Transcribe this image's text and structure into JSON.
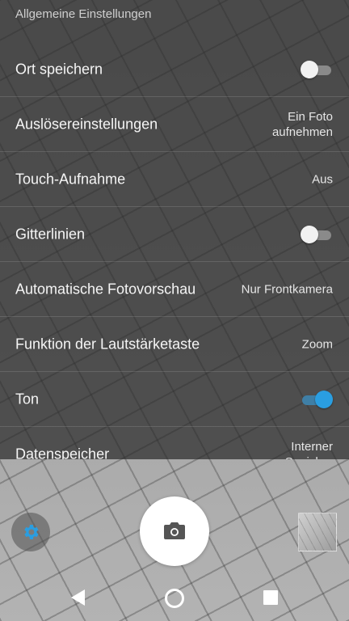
{
  "settings": {
    "section_title": "Allgemeine Einstellungen",
    "rows": [
      {
        "label": "Ort speichern",
        "type": "toggle",
        "on": false
      },
      {
        "label": "Auslösereinstellungen",
        "type": "value",
        "value": "Ein Foto\naufnehmen"
      },
      {
        "label": "Touch-Aufnahme",
        "type": "value",
        "value": "Aus"
      },
      {
        "label": "Gitterlinien",
        "type": "toggle",
        "on": false
      },
      {
        "label": "Automatische Fotovorschau",
        "type": "value",
        "value": "Nur Frontkamera"
      },
      {
        "label": "Funktion der Lautstärketaste",
        "type": "value",
        "value": "Zoom"
      },
      {
        "label": "Ton",
        "type": "toggle",
        "on": true
      },
      {
        "label": "Datenspeicher",
        "type": "value",
        "value": "Interner\nSpeicher"
      }
    ]
  },
  "controls": {
    "settings_icon": "gear-icon",
    "shutter_icon": "camera-icon",
    "thumbnail": "last-photo-thumbnail"
  },
  "navbar": {
    "back_icon": "back-triangle-icon",
    "home_icon": "home-circle-icon",
    "recents_icon": "recents-square-icon"
  },
  "colors": {
    "accent": "#2a9ee1",
    "overlay": "#282828"
  }
}
